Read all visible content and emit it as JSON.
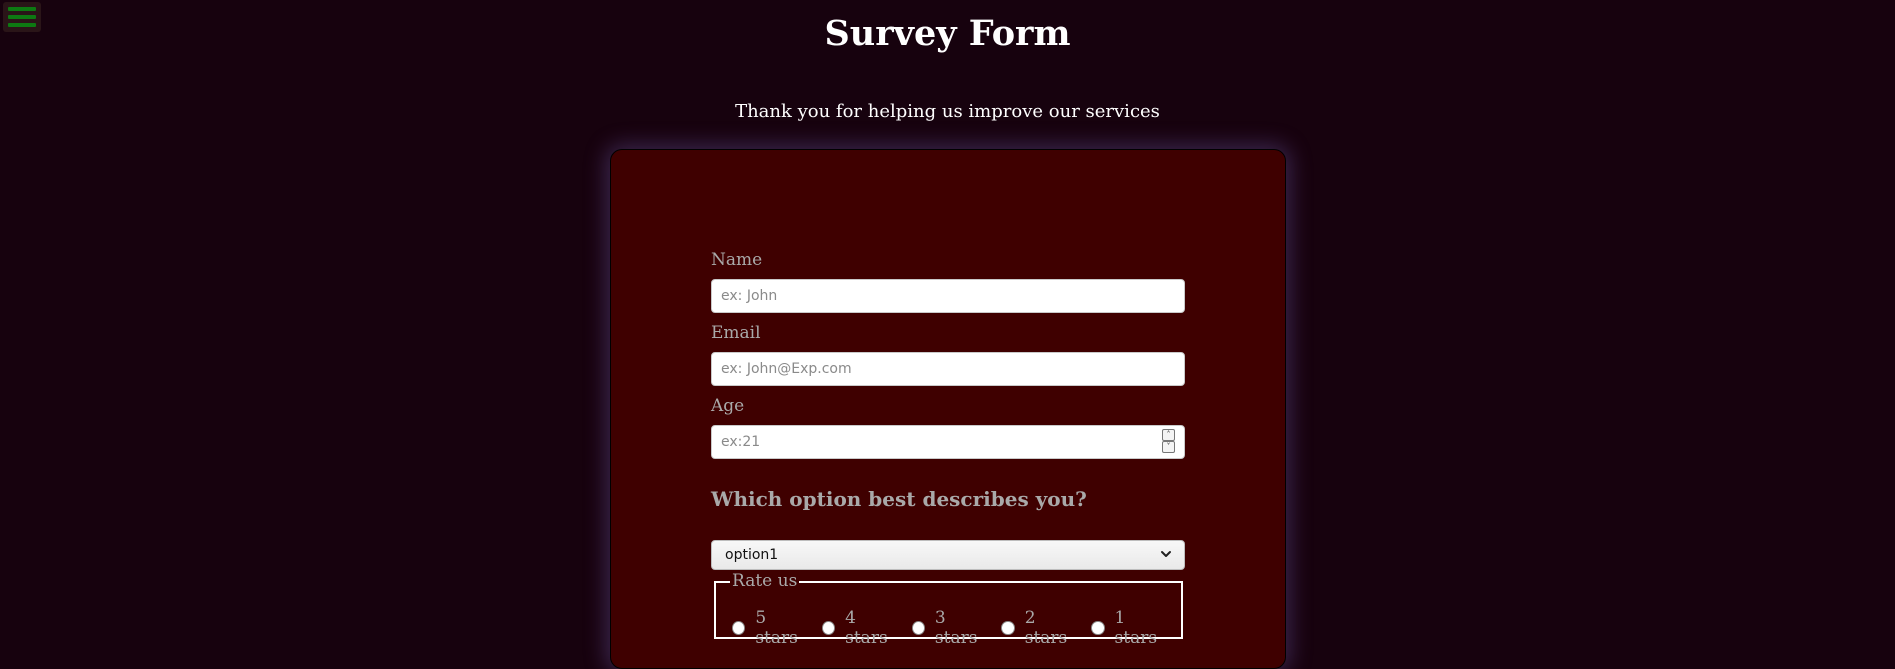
{
  "header": {
    "title": "Survey Form",
    "subtitle": "Thank you for helping us improve our services"
  },
  "menu": {
    "icon": "hamburger-menu-icon",
    "color": "#0d7a12"
  },
  "form": {
    "name": {
      "label": "Name",
      "placeholder": "ex: John",
      "value": ""
    },
    "email": {
      "label": "Email",
      "placeholder": "ex: John@Exp.com",
      "value": ""
    },
    "age": {
      "label": "Age",
      "placeholder": "ex:21",
      "value": ""
    },
    "question": "Which option best describes you?",
    "select": {
      "selected": "option1"
    },
    "rating": {
      "legend": "Rate us",
      "options": [
        {
          "label": "5 stars"
        },
        {
          "label": "4 stars"
        },
        {
          "label": "3 stars"
        },
        {
          "label": "2 stars"
        },
        {
          "label": "1 stars"
        }
      ]
    }
  },
  "colors": {
    "background": "#17020e",
    "card": "#3f0000",
    "label": "#a9a9a9",
    "menu_bars": "#0d7a12"
  }
}
